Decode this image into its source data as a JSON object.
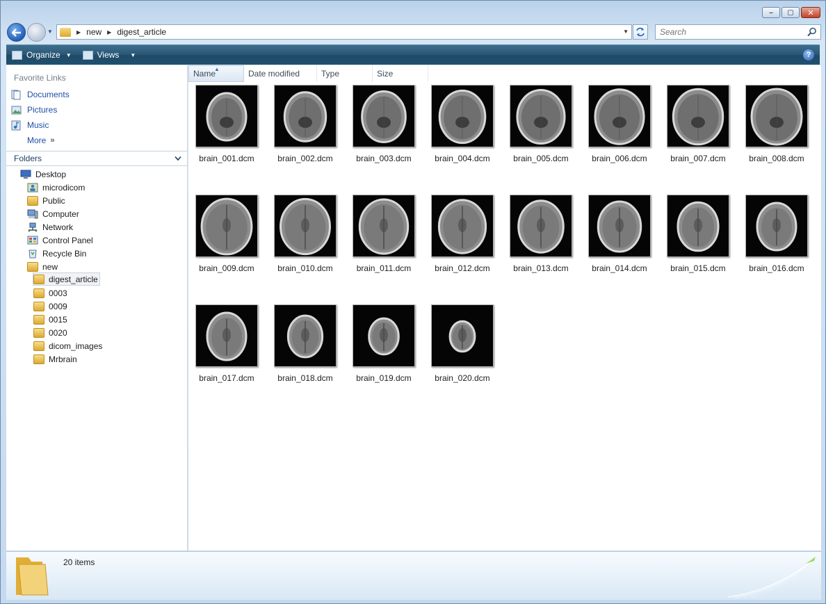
{
  "window": {
    "caption": {
      "minimize": "–",
      "maximize": "▢",
      "close": "✕"
    }
  },
  "navbar": {
    "breadcrumbs": [
      "new",
      "digest_article"
    ],
    "search_placeholder": "Search"
  },
  "toolbar": {
    "organize_label": "Organize",
    "views_label": "Views",
    "help_label": "?"
  },
  "favorites": {
    "header": "Favorite Links",
    "items": [
      {
        "label": "Documents",
        "icon": "documents-icon"
      },
      {
        "label": "Pictures",
        "icon": "pictures-icon"
      },
      {
        "label": "Music",
        "icon": "music-icon"
      }
    ],
    "more_label": "More",
    "more_glyph": "»"
  },
  "folders": {
    "header": "Folders",
    "tree": [
      {
        "label": "Desktop",
        "icon": "desktop-icon",
        "level": 0
      },
      {
        "label": "microdicom",
        "icon": "user-folder-icon",
        "level": 1
      },
      {
        "label": "Public",
        "icon": "folder-icon",
        "level": 1
      },
      {
        "label": "Computer",
        "icon": "computer-icon",
        "level": 1
      },
      {
        "label": "Network",
        "icon": "network-icon",
        "level": 1
      },
      {
        "label": "Control Panel",
        "icon": "control-panel-icon",
        "level": 1
      },
      {
        "label": "Recycle Bin",
        "icon": "recycle-bin-icon",
        "level": 1
      },
      {
        "label": "new",
        "icon": "folder-icon",
        "level": 1
      },
      {
        "label": "digest_article",
        "icon": "folder-icon",
        "level": 2,
        "selected": true
      },
      {
        "label": "0003",
        "icon": "folder-icon",
        "level": 2
      },
      {
        "label": "0009",
        "icon": "folder-icon",
        "level": 2
      },
      {
        "label": "0015",
        "icon": "folder-icon",
        "level": 2
      },
      {
        "label": "0020",
        "icon": "folder-icon",
        "level": 2
      },
      {
        "label": "dicom_images",
        "icon": "folder-icon",
        "level": 2
      },
      {
        "label": "Mrbrain",
        "icon": "folder-icon",
        "level": 2
      }
    ]
  },
  "columns": [
    "Name",
    "Date modified",
    "Type",
    "Size"
  ],
  "files": [
    "brain_001.dcm",
    "brain_002.dcm",
    "brain_003.dcm",
    "brain_004.dcm",
    "brain_005.dcm",
    "brain_006.dcm",
    "brain_007.dcm",
    "brain_008.dcm",
    "brain_009.dcm",
    "brain_010.dcm",
    "brain_011.dcm",
    "brain_012.dcm",
    "brain_013.dcm",
    "brain_014.dcm",
    "brain_015.dcm",
    "brain_016.dcm",
    "brain_017.dcm",
    "brain_018.dcm",
    "brain_019.dcm",
    "brain_020.dcm"
  ],
  "details": {
    "item_count": "20 items"
  }
}
